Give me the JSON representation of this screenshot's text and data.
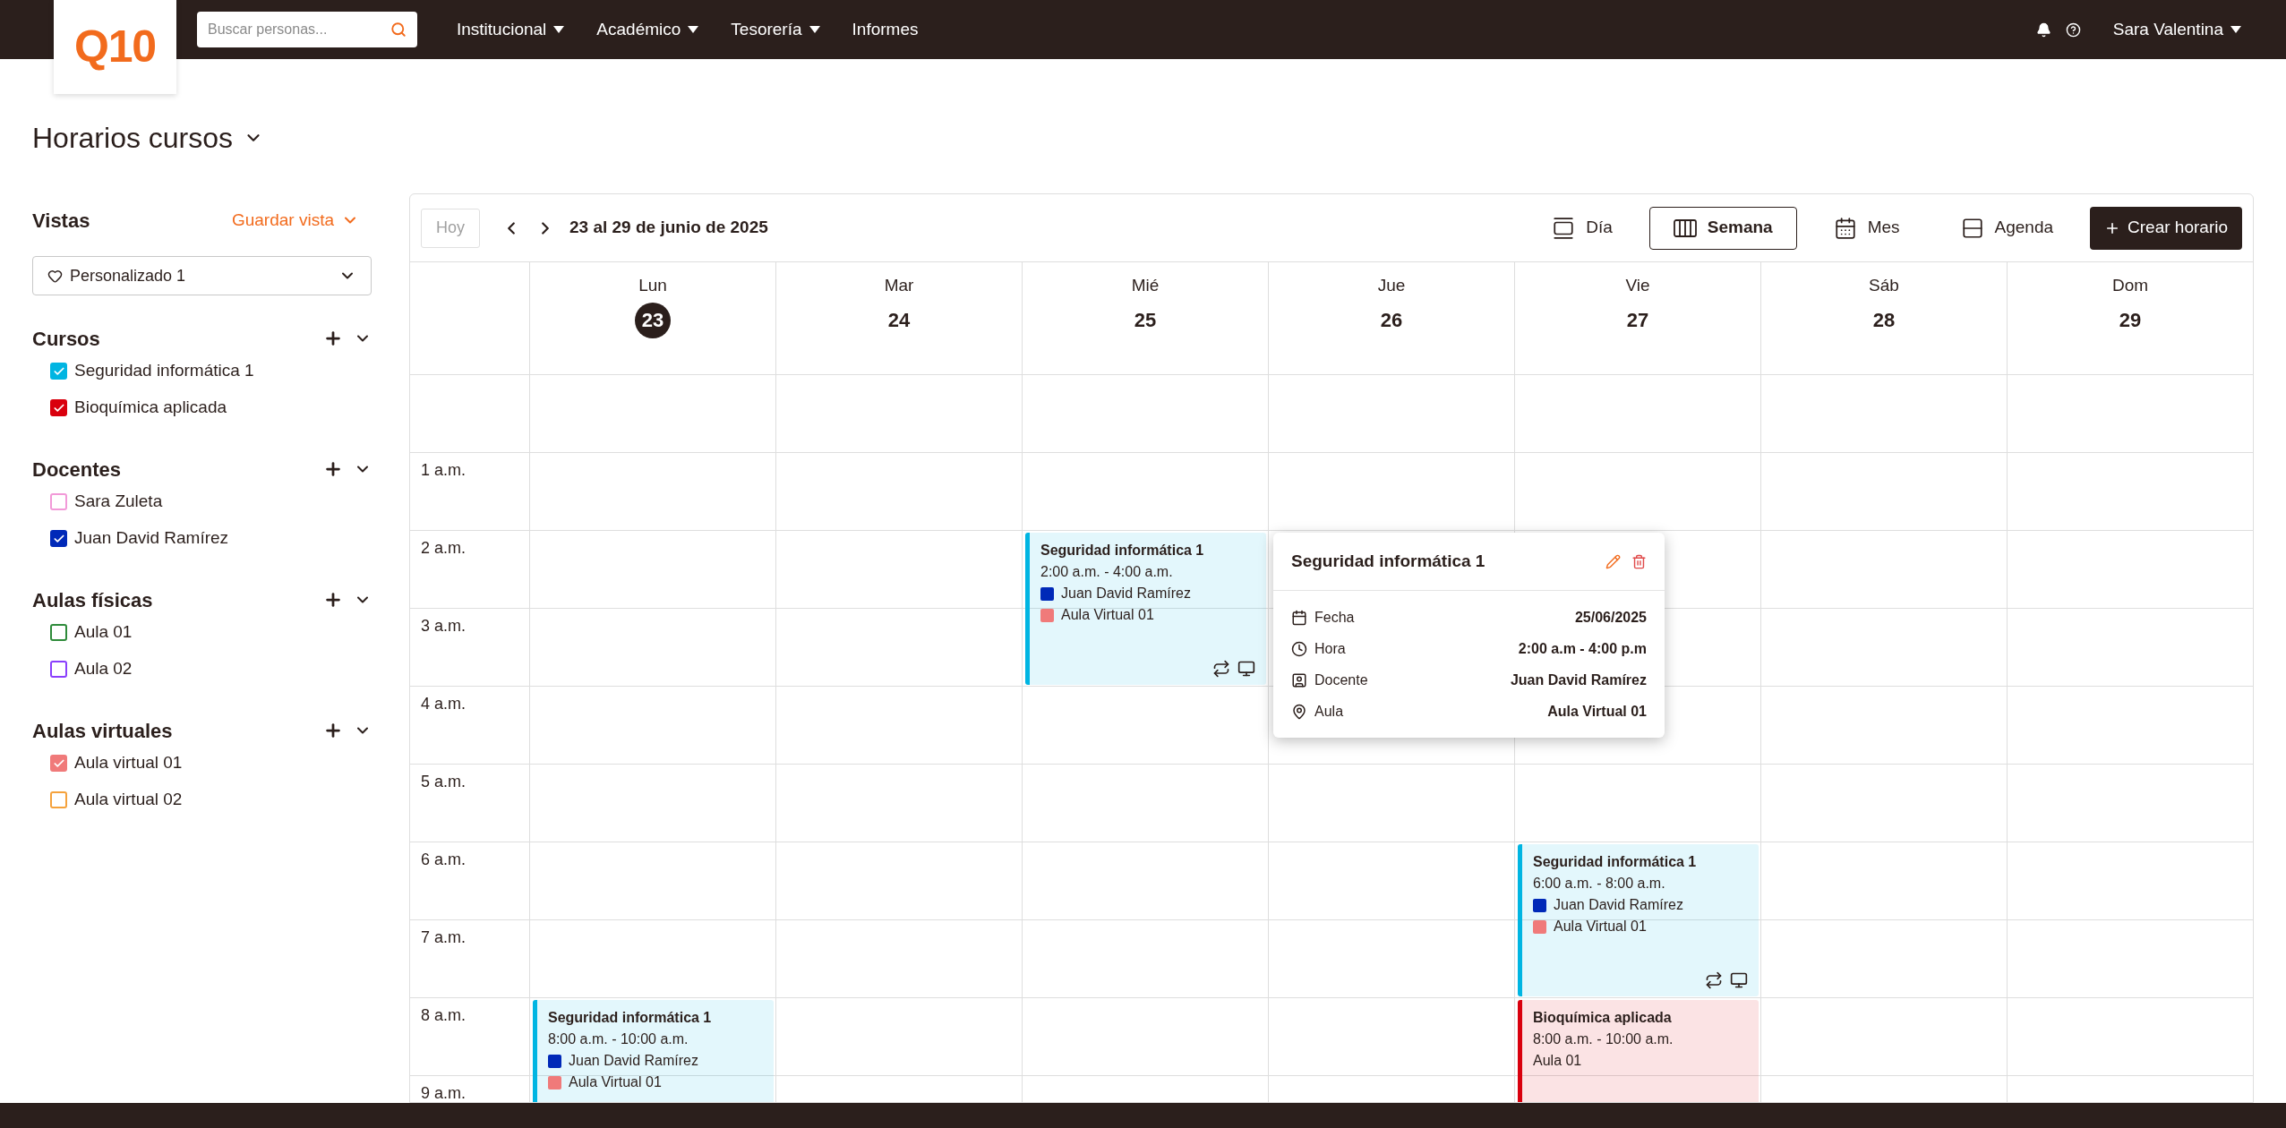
{
  "topbar": {
    "logo": "Q10",
    "search": {
      "placeholder": "Buscar personas..."
    },
    "nav": [
      {
        "label": "Institucional",
        "has_menu": true
      },
      {
        "label": "Académico",
        "has_menu": true
      },
      {
        "label": "Tesorería",
        "has_menu": true
      },
      {
        "label": "Informes",
        "has_menu": false
      }
    ],
    "user": "Sara Valentina"
  },
  "page": {
    "title": "Horarios cursos"
  },
  "sidebar": {
    "title": "Vistas",
    "save_view": "Guardar vista",
    "view_select": "Personalizado 1",
    "groups": [
      {
        "title": "Cursos",
        "items": [
          {
            "label": "Seguridad informática 1",
            "checked": true,
            "color": "#00b5e2"
          },
          {
            "label": "Bioquímica aplicada",
            "checked": true,
            "color": "#d9000d"
          }
        ]
      },
      {
        "title": "Docentes",
        "items": [
          {
            "label": "Sara Zuleta",
            "checked": false,
            "color": "#f29ad8"
          },
          {
            "label": "Juan David Ramírez",
            "checked": true,
            "color": "#0029b8"
          }
        ]
      },
      {
        "title": "Aulas físicas",
        "items": [
          {
            "label": "Aula 01",
            "checked": false,
            "color": "#2e8b3a"
          },
          {
            "label": "Aula 02",
            "checked": false,
            "color": "#8a3ffc"
          }
        ]
      },
      {
        "title": "Aulas virtuales",
        "items": [
          {
            "label": "Aula virtual 01",
            "checked": true,
            "color": "#f07a7a"
          },
          {
            "label": "Aula virtual 02",
            "checked": false,
            "color": "#f5a23c"
          }
        ]
      }
    ]
  },
  "toolbar": {
    "today": "Hoy",
    "today_disabled": true,
    "range": "23 al 29 de junio de 2025",
    "views": [
      {
        "label": "Día",
        "kind": "day",
        "selected": false
      },
      {
        "label": "Semana",
        "kind": "week",
        "selected": true
      },
      {
        "label": "Mes",
        "kind": "month",
        "selected": false
      },
      {
        "label": "Agenda",
        "kind": "agenda",
        "selected": false
      }
    ],
    "create": "Crear horario"
  },
  "days": [
    {
      "name": "Lun",
      "number": "23",
      "selected": true
    },
    {
      "name": "Mar",
      "number": "24",
      "selected": false
    },
    {
      "name": "Mié",
      "number": "25",
      "selected": false
    },
    {
      "name": "Jue",
      "number": "26",
      "selected": false
    },
    {
      "name": "Vie",
      "number": "27",
      "selected": false
    },
    {
      "name": "Sáb",
      "number": "28",
      "selected": false
    },
    {
      "name": "Dom",
      "number": "29",
      "selected": false
    }
  ],
  "hours": [
    {
      "cells": [
        {},
        {},
        {},
        {},
        {},
        {},
        {}
      ]
    },
    {
      "label": "1 a.m.",
      "cells": [
        {},
        {},
        {},
        {},
        {},
        {},
        {}
      ]
    },
    {
      "label": "2 a.m.",
      "cells": [
        {},
        {},
        {
          "event": {
            "title": "Seguridad informática 1",
            "time": "2:00 a.m. - 4:00 a.m.",
            "color": "#00b5e2",
            "teacher": {
              "name": "Juan David Ramírez",
              "color": "#0029b8"
            },
            "room": {
              "name": "Aula Virtual 01",
              "color": "#f07a7a"
            },
            "recurring": true,
            "virtual": true,
            "popup": {
              "title": "Seguridad informática 1",
              "rows": [
                {
                  "kind": "date",
                  "label": "Fecha",
                  "value": "25/06/2025"
                },
                {
                  "kind": "time",
                  "label": "Hora",
                  "value": "2:00 a.m - 4:00 p.m"
                },
                {
                  "kind": "teacher",
                  "label": "Docente",
                  "value": "Juan David Ramírez"
                },
                {
                  "kind": "room",
                  "label": "Aula",
                  "value": "Aula Virtual 01"
                }
              ]
            }
          }
        },
        {},
        {},
        {},
        {}
      ]
    },
    {
      "label": "3 a.m.",
      "cells": [
        {},
        {},
        {},
        {},
        {},
        {},
        {}
      ]
    },
    {
      "label": "4 a.m.",
      "cells": [
        {},
        {},
        {},
        {},
        {},
        {},
        {}
      ]
    },
    {
      "label": "5 a.m.",
      "cells": [
        {},
        {},
        {},
        {},
        {},
        {},
        {}
      ]
    },
    {
      "label": "6 a.m.",
      "cells": [
        {},
        {},
        {},
        {},
        {
          "event": {
            "title": "Seguridad informática 1",
            "time": "6:00 a.m. - 8:00 a.m.",
            "color": "#00b5e2",
            "teacher": {
              "name": "Juan David Ramírez",
              "color": "#0029b8"
            },
            "room": {
              "name": "Aula Virtual 01",
              "color": "#f07a7a"
            },
            "recurring": true,
            "virtual": true
          }
        },
        {},
        {}
      ]
    },
    {
      "label": "7 a.m.",
      "cells": [
        {},
        {},
        {},
        {},
        {},
        {},
        {}
      ]
    },
    {
      "label": "8 a.m.",
      "cells": [
        {
          "event": {
            "title": "Seguridad informática 1",
            "time": "8:00 a.m. - 10:00 a.m.",
            "color": "#00b5e2",
            "teacher": {
              "name": "Juan David Ramírez",
              "color": "#0029b8"
            },
            "room": {
              "name": "Aula Virtual 01",
              "color": "#f07a7a"
            }
          }
        },
        {},
        {},
        {},
        {
          "event": {
            "title": "Bioquímica aplicada",
            "time": "8:00 a.m. - 10:00 a.m.",
            "color": "#d9000d",
            "room": {
              "name": "Aula 01"
            }
          }
        },
        {},
        {}
      ]
    },
    {
      "label": "9 a.m.",
      "cells": [
        {},
        {},
        {},
        {},
        {},
        {},
        {}
      ]
    }
  ]
}
